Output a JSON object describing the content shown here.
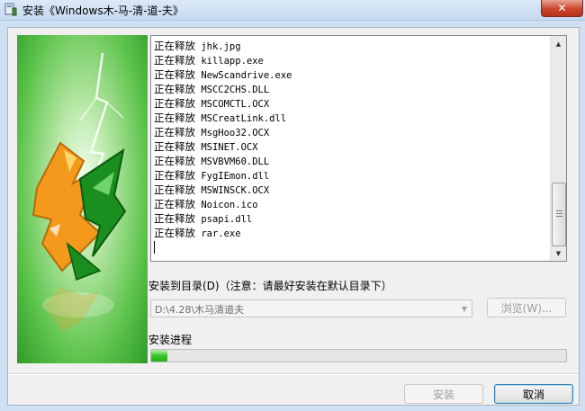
{
  "window": {
    "title": "安装《Windows木-马-清-道-夫》",
    "close_glyph": "✕"
  },
  "log": {
    "lines": [
      {
        "verb": "正在释放",
        "file": "jhk.jpg"
      },
      {
        "verb": "正在释放",
        "file": "killapp.exe"
      },
      {
        "verb": "正在释放",
        "file": "NewScandrive.exe"
      },
      {
        "verb": "正在释放",
        "file": "MSCC2CHS.DLL"
      },
      {
        "verb": "正在释放",
        "file": "MSCOMCTL.OCX"
      },
      {
        "verb": "正在释放",
        "file": "MSCreatLink.dll"
      },
      {
        "verb": "正在释放",
        "file": "MsgHoo32.OCX"
      },
      {
        "verb": "正在释放",
        "file": "MSINET.OCX"
      },
      {
        "verb": "正在释放",
        "file": "MSVBVM60.DLL"
      },
      {
        "verb": "正在释放",
        "file": "FygIEmon.dll"
      },
      {
        "verb": "正在释放",
        "file": "MSWINSCK.OCX"
      },
      {
        "verb": "正在释放",
        "file": "Noicon.ico"
      },
      {
        "verb": "正在释放",
        "file": "psapi.dll"
      },
      {
        "verb": "正在释放",
        "file": "rar.exe"
      }
    ]
  },
  "install_dir": {
    "label": "安装到目录(D)（注意：请最好安装在默认目录下）",
    "value": "D:\\4.28\\木马清道夫",
    "browse_label": "浏览(W)..."
  },
  "progress": {
    "label": "安装进程",
    "fraction": 0.04
  },
  "buttons": {
    "install_label": "安装",
    "cancel_label": "取消"
  },
  "colors": {
    "progress_fill": "#37c52a",
    "close_button": "#c9462c",
    "banner_green": "#5cc34a",
    "mascot_orange": "#f39a1d"
  }
}
